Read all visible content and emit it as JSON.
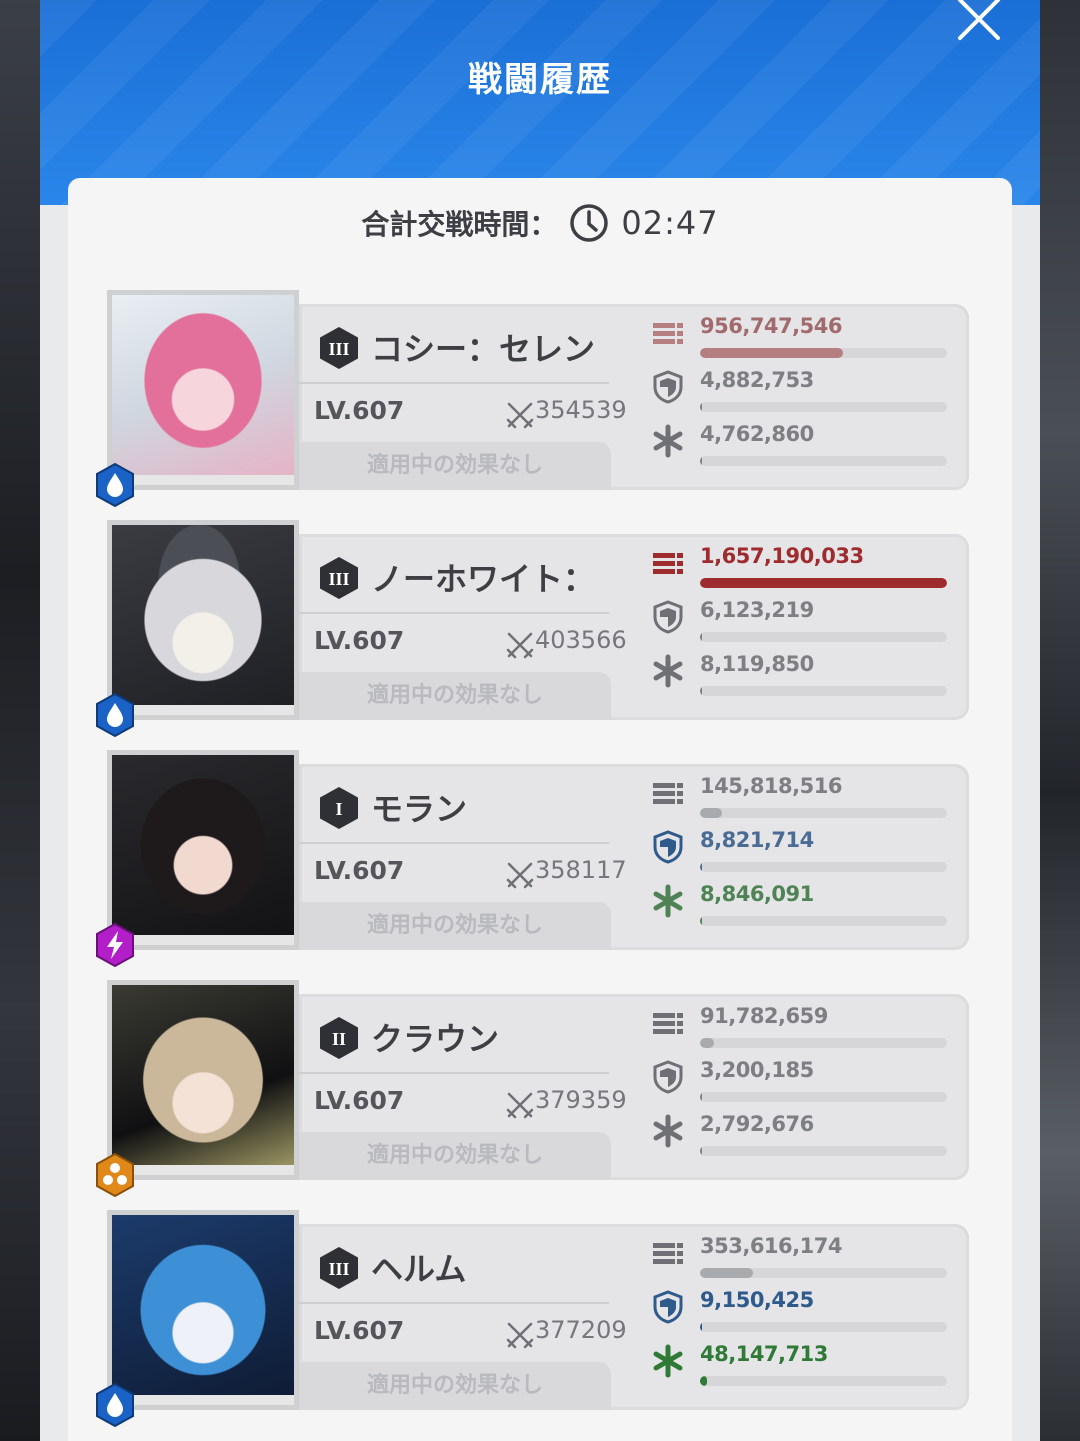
{
  "title": "戦闘履歴",
  "summary": {
    "label": "合計交戦時間：",
    "time": "02:47"
  },
  "colors": {
    "header_blue": "#1f7ae0",
    "damage_red": "#9e2b2e",
    "damage_faded": "#b57f82",
    "tank_blue": "#3a5f8c",
    "heal_green": "#3e7b44",
    "neutral_gray": "#75777b"
  },
  "units": [
    {
      "name": "コシー：セレン",
      "level": "LV.607",
      "power": "354539",
      "burst": "III",
      "element": "water",
      "effect": "適用中の効果なし",
      "damage": "956,747,546",
      "damage_ratio": 0.58,
      "damage_color": "#a16b6e",
      "tank": "4,882,753",
      "tank_ratio": 0.005,
      "tank_color": "#7d7f83",
      "heal": "4,762,860",
      "heal_ratio": 0.004,
      "heal_color": "#7d7f83"
    },
    {
      "name": "ノーホワイト：",
      "level": "LV.607",
      "power": "403566",
      "burst": "III",
      "element": "water",
      "effect": "適用中の効果なし",
      "damage": "1,657,190,033",
      "damage_ratio": 1.0,
      "damage_color": "#9e2b2e",
      "tank": "6,123,219",
      "tank_ratio": 0.005,
      "tank_color": "#7d7f83",
      "heal": "8,119,850",
      "heal_ratio": 0.006,
      "heal_color": "#7d7f83"
    },
    {
      "name": "モラン",
      "level": "LV.607",
      "power": "358117",
      "burst": "I",
      "element": "electric",
      "effect": "適用中の効果なし",
      "damage": "145,818,516",
      "damage_ratio": 0.088,
      "damage_color": "#7d7f83",
      "tank": "8,821,714",
      "tank_ratio": 0.005,
      "tank_color": "#4a6c94",
      "heal": "8,846,091",
      "heal_ratio": 0.006,
      "heal_color": "#4f8355"
    },
    {
      "name": "クラウン",
      "level": "LV.607",
      "power": "379359",
      "burst": "II",
      "element": "iron",
      "effect": "適用中の効果なし",
      "damage": "91,782,659",
      "damage_ratio": 0.055,
      "damage_color": "#7d7f83",
      "tank": "3,200,185",
      "tank_ratio": 0.003,
      "tank_color": "#7d7f83",
      "heal": "2,792,676",
      "heal_ratio": 0.002,
      "heal_color": "#7d7f83"
    },
    {
      "name": "ヘルム",
      "level": "LV.607",
      "power": "377209",
      "burst": "III",
      "element": "water",
      "effect": "適用中の効果なし",
      "damage": "353,616,174",
      "damage_ratio": 0.213,
      "damage_color": "#7d7f83",
      "tank": "9,150,425",
      "tank_ratio": 0.006,
      "tank_color": "#2e5a8c",
      "heal": "48,147,713",
      "heal_ratio": 0.03,
      "heal_color": "#2f7a36"
    }
  ]
}
